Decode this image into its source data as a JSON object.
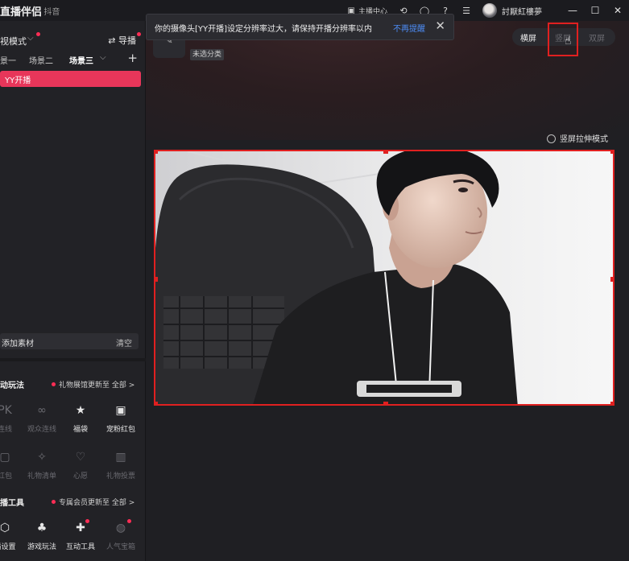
{
  "titlebar": {
    "app_name": "直播伴侣",
    "app_sub": "· 抖音",
    "anchor_center": "主播中心",
    "user_name": "討厭紅樓夢",
    "icons": [
      "clipboard-icon",
      "refresh-icon",
      "chat-icon",
      "help-icon",
      "menu-icon",
      "minimize-icon",
      "maximize-icon",
      "close-icon"
    ]
  },
  "left": {
    "mode_label": "视模式",
    "guide_label": "导播",
    "scenes": [
      "景一",
      "场景二",
      "场景三"
    ],
    "source_label": "YY开播",
    "add_material": "添加素材",
    "clear": "清空",
    "play_section": {
      "title": "动玩法",
      "note": "礼物展馆更新至 全部 >",
      "items": [
        {
          "label": "连线",
          "icon": "PK",
          "lit": false
        },
        {
          "label": "观众连线",
          "icon": "∞",
          "lit": false
        },
        {
          "label": "福袋",
          "icon": "★",
          "lit": true
        },
        {
          "label": "宠粉红包",
          "icon": "▣",
          "lit": true
        },
        {
          "label": "红包",
          "icon": "▢",
          "lit": false
        },
        {
          "label": "礼物清单",
          "icon": "✧",
          "lit": false
        },
        {
          "label": "心愿",
          "icon": "♡",
          "lit": false
        },
        {
          "label": "礼物投票",
          "icon": "▥",
          "lit": false
        }
      ]
    },
    "tools_section": {
      "title": "播工具",
      "note": "专属会员更新至 全部 >",
      "items": [
        {
          "label": "播设置",
          "icon": "⬡",
          "lit": true
        },
        {
          "label": "游戏玩法",
          "icon": "♣",
          "lit": true
        },
        {
          "label": "互动工具",
          "icon": "✚",
          "lit": true
        },
        {
          "label": "人气宝箱",
          "icon": "◍",
          "lit": false
        }
      ]
    }
  },
  "main": {
    "uncategorized": "未选分类",
    "toast": {
      "message": "你的摄像头[YY开播]设定分辨率过大，请保持开播分辨率以内",
      "link": "不再提醒",
      "close": "✕"
    },
    "orientation": {
      "options": [
        "横屏",
        "竖屏",
        "双屏"
      ],
      "selected": "横屏"
    },
    "stretch_label": "竖屏拉伸模式",
    "preview_label": "camera-preview"
  },
  "colors": {
    "accent": "#e8365a",
    "highlight": "#e02020",
    "link": "#4d8cf5",
    "badge": "#ff2d55"
  }
}
